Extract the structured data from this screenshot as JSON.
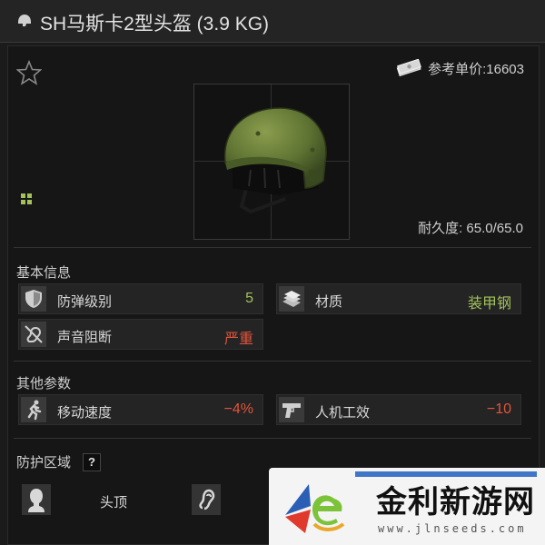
{
  "item": {
    "title": "SH马斯卡2型头盔 (3.9 KG)",
    "price_label": "参考单价:16603",
    "durability_label": "耐久度: 65.0/65.0"
  },
  "sections": {
    "basic": "基本信息",
    "other": "其他参数",
    "protection": "防护区域",
    "help": "?"
  },
  "basic_stats": [
    {
      "icon": "shield-icon",
      "label": "防弹级别",
      "value": "5",
      "color": "#a2c25a"
    },
    {
      "icon": "armor-plates-icon",
      "label": "材质",
      "value": "装甲钢",
      "color": "#a2c25a"
    },
    {
      "icon": "muted-ear-icon",
      "label": "声音阻断",
      "value": "严重",
      "color": "#e0553c"
    }
  ],
  "other_stats": [
    {
      "icon": "running-man-icon",
      "label": "移动速度",
      "value": "−4%",
      "color": "#e0553c"
    },
    {
      "icon": "pistol-icon",
      "label": "人机工效",
      "value": "−10",
      "color": "#e0553c"
    }
  ],
  "protection_zones": [
    {
      "icon": "head-silhouette-icon",
      "label": "头顶"
    },
    {
      "icon": "ear-icon",
      "label": ""
    }
  ],
  "watermark": {
    "text": "金利新游网",
    "url": "www.jlnseeds.com"
  },
  "colors": {
    "positive": "#a2c25a",
    "negative": "#e0553c",
    "helmet": "#5f7433"
  }
}
